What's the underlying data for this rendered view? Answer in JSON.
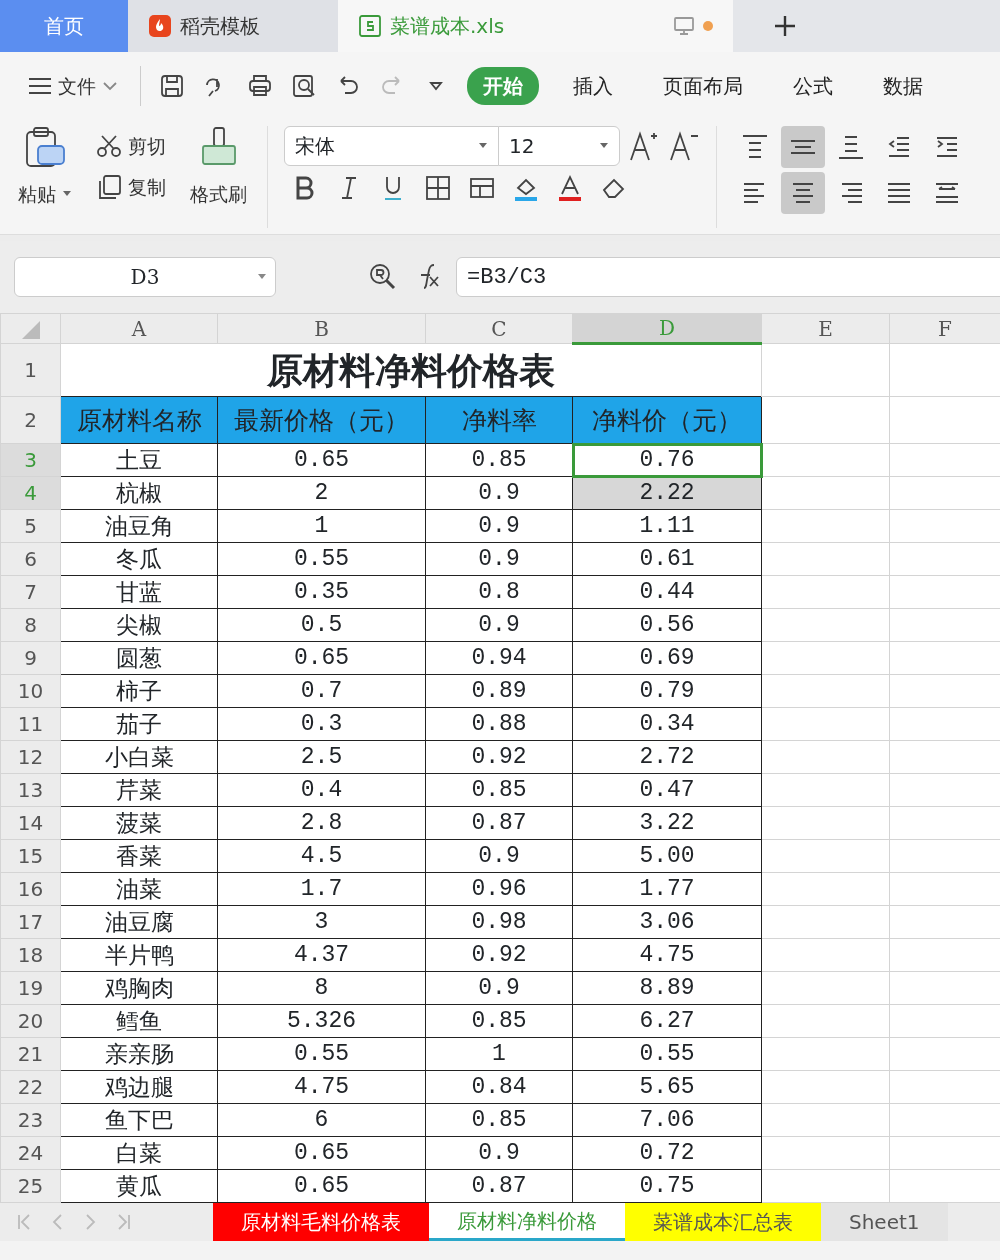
{
  "doc_tabs": [
    {
      "label": "首页",
      "kind": "home",
      "selected": false
    },
    {
      "label": "稻壳模板",
      "kind": "docer",
      "selected": false
    },
    {
      "label": "菜谱成本.xls",
      "kind": "sheet",
      "selected": true
    }
  ],
  "menu": {
    "file": "文件",
    "tabs": [
      {
        "label": "开始",
        "selected": true
      },
      {
        "label": "插入",
        "selected": false
      },
      {
        "label": "页面布局",
        "selected": false
      },
      {
        "label": "公式",
        "selected": false
      },
      {
        "label": "数据",
        "selected": false
      }
    ]
  },
  "ribbon": {
    "paste": "粘贴",
    "cut": "剪切",
    "copy": "复制",
    "format_painter": "格式刷",
    "font_name": "宋体",
    "font_size": "12",
    "align_top": [
      {
        "kind": "top",
        "selected": false
      },
      {
        "kind": "middle",
        "selected": true
      },
      {
        "kind": "bottom",
        "selected": false
      },
      {
        "kind": "outdent",
        "selected": false
      },
      {
        "kind": "indent",
        "selected": false
      }
    ],
    "align_bottom": [
      {
        "kind": "left",
        "selected": false
      },
      {
        "kind": "center",
        "selected": true
      },
      {
        "kind": "right",
        "selected": false
      },
      {
        "kind": "justify",
        "selected": false
      },
      {
        "kind": "distributed",
        "selected": false
      }
    ]
  },
  "formula_bar": {
    "cell_ref": "D3",
    "formula": "=B3/C3"
  },
  "columns": [
    {
      "label": "A",
      "selected": false
    },
    {
      "label": "B",
      "selected": false
    },
    {
      "label": "C",
      "selected": false
    },
    {
      "label": "D",
      "selected": true
    },
    {
      "label": "E",
      "selected": false
    },
    {
      "label": "F",
      "selected": false
    }
  ],
  "title_row": {
    "num": "1",
    "text": "原材料净料价格表"
  },
  "header_row": {
    "num": "2",
    "cells": [
      "原材料名称",
      "最新价格（元）",
      "净料率",
      "净料价（元）"
    ]
  },
  "rows": [
    {
      "num": "3",
      "selected": true,
      "active": true,
      "cells": [
        "土豆",
        "0.65",
        "0.85",
        "0.76"
      ]
    },
    {
      "num": "4",
      "selected": true,
      "active": false,
      "cells": [
        "杭椒",
        "2",
        "0.9",
        "2.22"
      ]
    },
    {
      "num": "5",
      "selected": false,
      "active": false,
      "cells": [
        "油豆角",
        "1",
        "0.9",
        "1.11"
      ]
    },
    {
      "num": "6",
      "selected": false,
      "active": false,
      "cells": [
        "冬瓜",
        "0.55",
        "0.9",
        "0.61"
      ]
    },
    {
      "num": "7",
      "selected": false,
      "active": false,
      "cells": [
        "甘蓝",
        "0.35",
        "0.8",
        "0.44"
      ]
    },
    {
      "num": "8",
      "selected": false,
      "active": false,
      "cells": [
        "尖椒",
        "0.5",
        "0.9",
        "0.56"
      ]
    },
    {
      "num": "9",
      "selected": false,
      "active": false,
      "cells": [
        "圆葱",
        "0.65",
        "0.94",
        "0.69"
      ]
    },
    {
      "num": "10",
      "selected": false,
      "active": false,
      "cells": [
        "柿子",
        "0.7",
        "0.89",
        "0.79"
      ]
    },
    {
      "num": "11",
      "selected": false,
      "active": false,
      "cells": [
        "茄子",
        "0.3",
        "0.88",
        "0.34"
      ]
    },
    {
      "num": "12",
      "selected": false,
      "active": false,
      "cells": [
        "小白菜",
        "2.5",
        "0.92",
        "2.72"
      ]
    },
    {
      "num": "13",
      "selected": false,
      "active": false,
      "cells": [
        "芹菜",
        "0.4",
        "0.85",
        "0.47"
      ]
    },
    {
      "num": "14",
      "selected": false,
      "active": false,
      "cells": [
        "菠菜",
        "2.8",
        "0.87",
        "3.22"
      ]
    },
    {
      "num": "15",
      "selected": false,
      "active": false,
      "cells": [
        "香菜",
        "4.5",
        "0.9",
        "5.00"
      ]
    },
    {
      "num": "16",
      "selected": false,
      "active": false,
      "cells": [
        "油菜",
        "1.7",
        "0.96",
        "1.77"
      ]
    },
    {
      "num": "17",
      "selected": false,
      "active": false,
      "cells": [
        "油豆腐",
        "3",
        "0.98",
        "3.06"
      ]
    },
    {
      "num": "18",
      "selected": false,
      "active": false,
      "cells": [
        "半片鸭",
        "4.37",
        "0.92",
        "4.75"
      ]
    },
    {
      "num": "19",
      "selected": false,
      "active": false,
      "cells": [
        "鸡胸肉",
        "8",
        "0.9",
        "8.89"
      ]
    },
    {
      "num": "20",
      "selected": false,
      "active": false,
      "cells": [
        "鳕鱼",
        "5.326",
        "0.85",
        "6.27"
      ]
    },
    {
      "num": "21",
      "selected": false,
      "active": false,
      "cells": [
        "亲亲肠",
        "0.55",
        "1",
        "0.55"
      ]
    },
    {
      "num": "22",
      "selected": false,
      "active": false,
      "cells": [
        "鸡边腿",
        "4.75",
        "0.84",
        "5.65"
      ]
    },
    {
      "num": "23",
      "selected": false,
      "active": false,
      "cells": [
        "鱼下巴",
        "6",
        "0.85",
        "7.06"
      ]
    },
    {
      "num": "24",
      "selected": false,
      "active": false,
      "cells": [
        "白菜",
        "0.65",
        "0.9",
        "0.72"
      ]
    },
    {
      "num": "25",
      "selected": false,
      "active": false,
      "cells": [
        "黄瓜",
        "0.65",
        "0.87",
        "0.75"
      ]
    }
  ],
  "sheet_tabs": [
    {
      "label": "原材料毛料价格表",
      "color": "#ff0000",
      "selected": false
    },
    {
      "label": "原材料净料价格",
      "color": "#ffffff",
      "selected": true
    },
    {
      "label": "菜谱成本汇总表",
      "color": "#ffff00",
      "selected": false
    },
    {
      "label": "Sheet1",
      "color": "#e4e4e4",
      "selected": false
    }
  ]
}
